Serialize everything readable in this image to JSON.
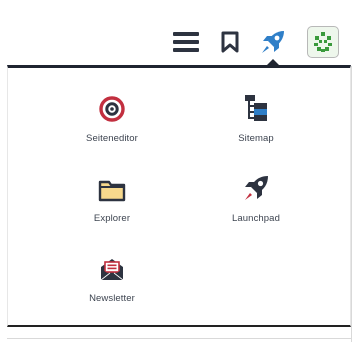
{
  "toolbar": {
    "buttons": [
      {
        "icon": "hamburger-menu-icon"
      },
      {
        "icon": "bookmark-icon"
      },
      {
        "icon": "rocket-icon",
        "active": true
      },
      {
        "icon": "user-avatar-icon"
      }
    ]
  },
  "colors": {
    "dark": "#2d3340",
    "accent_blue": "#2f7fc8",
    "target_red": "#c22f3f",
    "folder_fill": "#f7d98d",
    "avatar_green": "#3a9a3c"
  },
  "menu": {
    "items": [
      {
        "label": "Seiteneditor",
        "icon": "target-icon"
      },
      {
        "label": "Sitemap",
        "icon": "sitemap-icon"
      },
      {
        "label": "Explorer",
        "icon": "folder-icon"
      },
      {
        "label": "Launchpad",
        "icon": "rocket-icon"
      },
      {
        "label": "Newsletter",
        "icon": "newsletter-icon"
      }
    ]
  }
}
